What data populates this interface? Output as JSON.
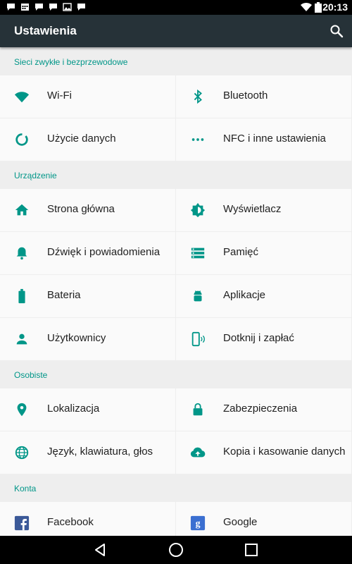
{
  "status_bar": {
    "time": "20:13",
    "notification_icons": [
      "chat-icon",
      "calendar-icon",
      "chat-icon",
      "chat-icon",
      "image-icon",
      "chat-icon"
    ]
  },
  "toolbar": {
    "title": "Ustawienia",
    "search_icon": "search-icon"
  },
  "accent_color": "#009688",
  "sections": [
    {
      "title": "Sieci zwykłe i bezprzewodowe",
      "items": [
        {
          "label": "Wi-Fi",
          "icon": "wifi-icon"
        },
        {
          "label": "Bluetooth",
          "icon": "bluetooth-icon"
        },
        {
          "label": "Użycie danych",
          "icon": "data-usage-icon"
        },
        {
          "label": "NFC i inne ustawienia",
          "icon": "more-icon"
        }
      ]
    },
    {
      "title": "Urządzenie",
      "items": [
        {
          "label": "Strona główna",
          "icon": "home-icon"
        },
        {
          "label": "Wyświetlacz",
          "icon": "brightness-icon"
        },
        {
          "label": "Dźwięk i powiadomienia",
          "icon": "bell-icon"
        },
        {
          "label": "Pamięć",
          "icon": "storage-icon"
        },
        {
          "label": "Bateria",
          "icon": "battery-icon"
        },
        {
          "label": "Aplikacje",
          "icon": "android-icon"
        },
        {
          "label": "Użytkownicy",
          "icon": "user-icon"
        },
        {
          "label": "Dotknij i zapłać",
          "icon": "tap-pay-icon"
        }
      ]
    },
    {
      "title": "Osobiste",
      "items": [
        {
          "label": "Lokalizacja",
          "icon": "location-icon"
        },
        {
          "label": "Zabezpieczenia",
          "icon": "lock-icon"
        },
        {
          "label": "Język, klawiatura, głos",
          "icon": "globe-icon"
        },
        {
          "label": "Kopia i kasowanie danych",
          "icon": "cloud-upload-icon"
        }
      ]
    },
    {
      "title": "Konta",
      "items": [
        {
          "label": "Facebook",
          "icon": "facebook-icon"
        },
        {
          "label": "Google",
          "icon": "google-icon"
        }
      ]
    }
  ],
  "nav_bar": {
    "back": "back-icon",
    "home": "home-circle-icon",
    "recents": "recents-icon"
  }
}
